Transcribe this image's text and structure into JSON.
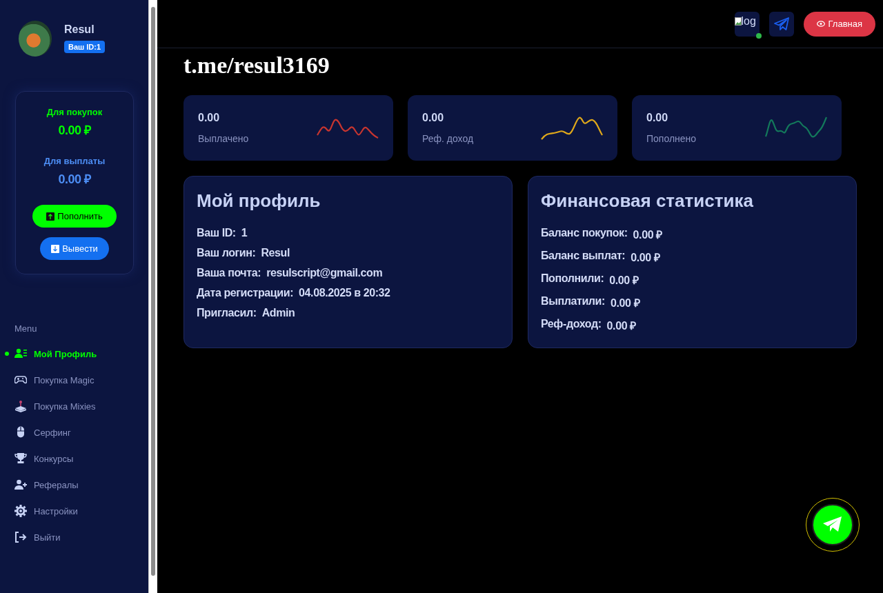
{
  "user": {
    "name": "Resul",
    "id_badge": "Ваш ID:1"
  },
  "balance": {
    "purchase_label": "Для покупок",
    "purchase_value": "0.00 ₽",
    "payout_label": "Для выплаты",
    "payout_value": "0.00 ₽",
    "buttons": [
      "Пополнить",
      "Вывести"
    ]
  },
  "menu": {
    "heading": "Menu",
    "items": [
      {
        "label": "Мой Профиль",
        "selected": true
      },
      {
        "label": "Покупка Magic",
        "selected": false
      },
      {
        "label": "Покупка Mixies",
        "selected": false
      },
      {
        "label": "Серфинг",
        "selected": false
      },
      {
        "label": "Конкурсы",
        "selected": false
      },
      {
        "label": "Рефералы",
        "selected": false
      },
      {
        "label": "Настройки",
        "selected": false
      },
      {
        "label": "Выйти",
        "selected": false
      }
    ]
  },
  "header": {
    "logo_alt": "log",
    "home_button": "Главная"
  },
  "title": "t.me/resul3169",
  "stats": [
    {
      "value": "0.00",
      "label": "Выплачено",
      "color": "#c8352f"
    },
    {
      "value": "0.00",
      "label": "Реф. доход",
      "color": "#e0a81a"
    },
    {
      "value": "0.00",
      "label": "Пополнено",
      "color": "#13795b"
    }
  ],
  "profile": {
    "title": "Мой профиль",
    "rows": [
      {
        "label": "Ваш ID:",
        "value": "1"
      },
      {
        "label": "Ваш логин:",
        "value": "Resul"
      },
      {
        "label": "Ваша почта:",
        "value": "resulscript@gmail.com"
      },
      {
        "label": "Дата регистрации:",
        "value": "04.08.2025 в 20:32"
      },
      {
        "label": "Пригласил:",
        "value": "Admin"
      }
    ]
  },
  "finance": {
    "title": "Финансовая статистика",
    "rows": [
      {
        "label": "Баланс покупок:",
        "value": "0.00 ₽"
      },
      {
        "label": "Баланс выплат:",
        "value": "0.00 ₽"
      },
      {
        "label": "Пополнили:",
        "value": "0.00 ₽"
      },
      {
        "label": "Выплатили:",
        "value": "0.00 ₽"
      },
      {
        "label": "Реф-доход:",
        "value": "0.00 ₽"
      }
    ]
  }
}
